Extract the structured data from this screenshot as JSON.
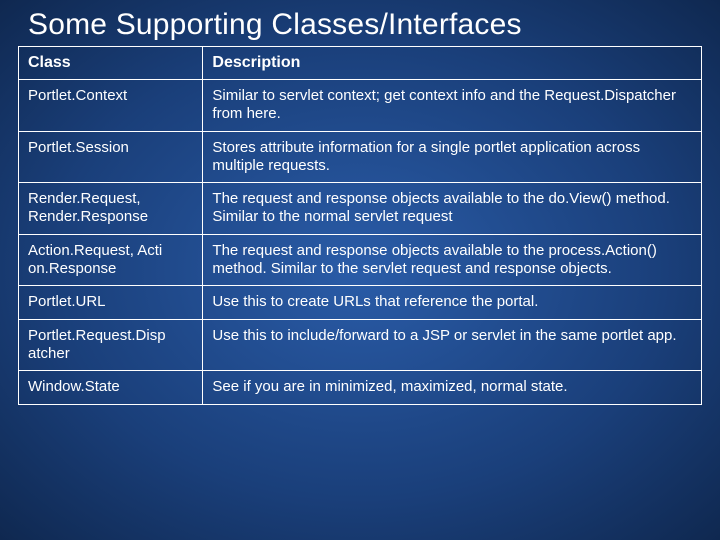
{
  "title": "Some Supporting Classes/Interfaces",
  "headers": {
    "class": "Class",
    "description": "Description"
  },
  "rows": [
    {
      "class": "Portlet.Context",
      "description": "Similar to servlet context; get context info and the Request.Dispatcher from here."
    },
    {
      "class": "Portlet.Session",
      "description": "Stores attribute information for a single portlet application across multiple requests."
    },
    {
      "class": "Render.Request, Render.Response",
      "description": "The request and response objects available to the do.View() method. Similar to the normal servlet request"
    },
    {
      "class": "Action.Request, Acti on.Response",
      "description": "The request and response objects available to the process.Action() method. Similar to the servlet request and response objects."
    },
    {
      "class": "Portlet.URL",
      "description": "Use this to create URLs that reference the portal."
    },
    {
      "class": "Portlet.Request.Disp atcher",
      "description": "Use this to include/forward to a JSP or servlet in the same portlet app."
    },
    {
      "class": "Window.State",
      "description": "See if you are in minimized, maximized, normal state."
    }
  ]
}
